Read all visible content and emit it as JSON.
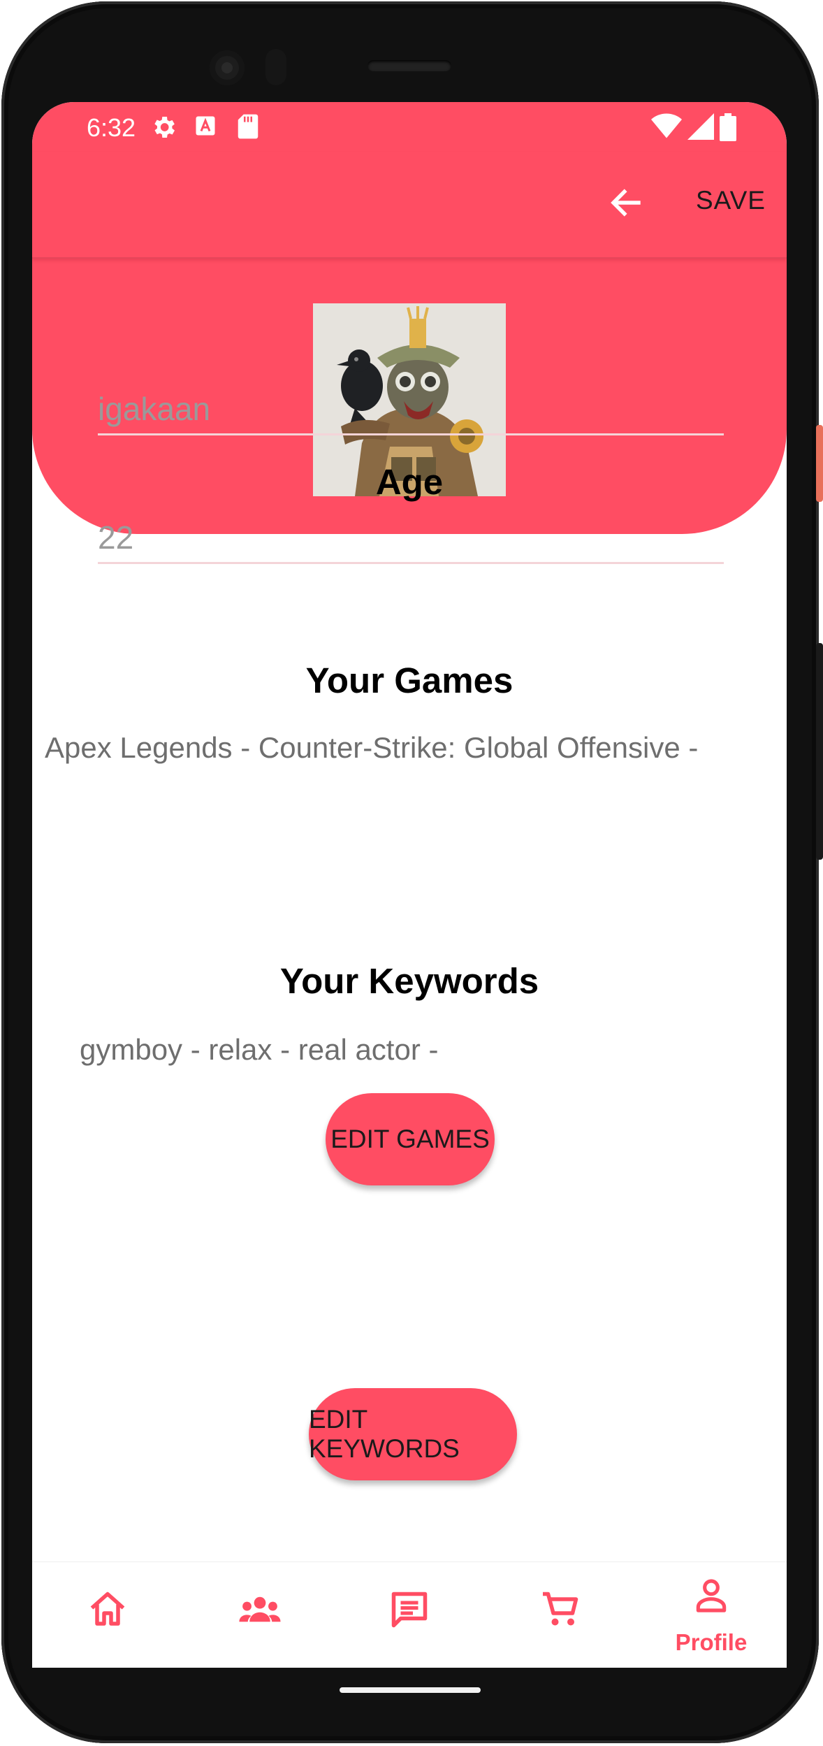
{
  "status_bar": {
    "time": "6:32",
    "icons": [
      "gear-icon",
      "text-a-icon",
      "sd-card-icon",
      "wifi-icon",
      "signal-icon",
      "battery-icon"
    ]
  },
  "toolbar": {
    "back_icon": "arrow-left-icon",
    "save_label": "SAVE"
  },
  "profile": {
    "username_value": "igakaan",
    "age_heading": "Age",
    "age_value": "22",
    "games_heading": "Your Games",
    "games_text": "Apex Legends - Counter-Strike: Global Offensive -",
    "edit_games_label": "EDIT GAMES",
    "keywords_heading": "Your Keywords",
    "keywords_text": "gymboy - relax - real actor -",
    "edit_keywords_label": "EDIT KEYWORDS"
  },
  "bottom_nav": {
    "items": [
      {
        "icon": "home-icon",
        "label": ""
      },
      {
        "icon": "people-icon",
        "label": ""
      },
      {
        "icon": "chat-icon",
        "label": ""
      },
      {
        "icon": "cart-icon",
        "label": ""
      },
      {
        "icon": "person-icon",
        "label": "Profile"
      }
    ]
  },
  "colors": {
    "accent": "#ff4d63",
    "text_dark": "#000000",
    "text_muted": "#6e6e6e"
  }
}
